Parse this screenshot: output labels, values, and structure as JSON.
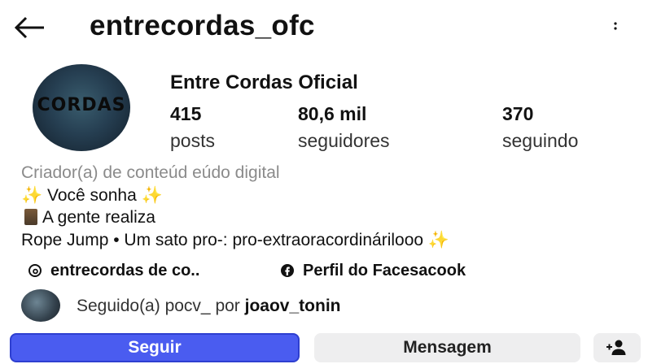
{
  "header": {
    "username": "entrecordas_ofc",
    "back_icon": "arrow-left-icon",
    "more_icon": "more-vertical-icon"
  },
  "profile": {
    "display_name": "Entre Cordas Oficial",
    "avatar_text": "CORDAS",
    "stats": [
      {
        "value": "415",
        "label": "posts"
      },
      {
        "value": "80,6 mil",
        "label": "seguidores"
      },
      {
        "value": "370",
        "label": "seguindo"
      }
    ]
  },
  "bio": {
    "category": "Criador(a) de conteúd eúdo digital",
    "line1_sparkle_left": "✨",
    "line1": "Você sonha",
    "line1_sparkle_right": "✨",
    "line2": "A gente realiza",
    "line3": "Rope Jump • Um sato pro-: pro-extraoracordinárilooo",
    "line3_sparkle": "✨"
  },
  "links": {
    "threads_label": "entrecordas de co..",
    "facebook_label": "Perfil do Facesacook"
  },
  "followed_by": {
    "prefix": "Seguido(a) pocv_ por",
    "username": "joaov_tonin"
  },
  "actions": {
    "follow_label": "Seguir",
    "message_label": "Mensagem",
    "add_user_icon": "add-person-icon"
  },
  "colors": {
    "follow_button": "#4a5cf0",
    "secondary_button": "#eeeeef",
    "category_text": "#8b8b8b",
    "sparkle": "#e8b218"
  }
}
